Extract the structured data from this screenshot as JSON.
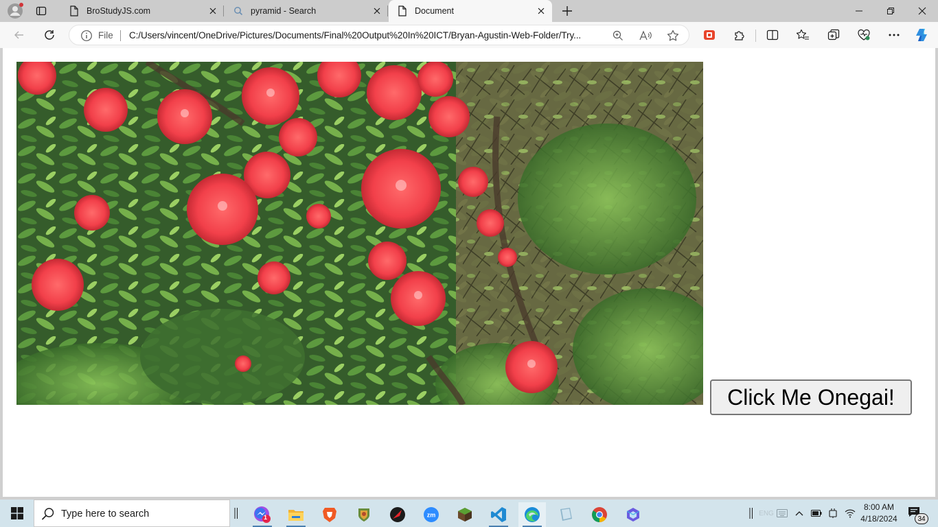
{
  "browser": {
    "tabs": [
      {
        "title": "BroStudyJS.com",
        "icon": "page-icon",
        "active": false
      },
      {
        "title": "pyramid - Search",
        "icon": "search-icon",
        "active": false
      },
      {
        "title": "Document",
        "icon": "page-icon",
        "active": true
      }
    ],
    "address": {
      "scheme_label": "File",
      "url": "C:/Users/vincent/OneDrive/Pictures/Documents/Final%20Output%20In%20ICT/Bryan-Agustin-Web-Folder/Try..."
    }
  },
  "page": {
    "photo": {
      "subject": "red ixora flowers bush"
    },
    "button_label": "Click Me Onegai!"
  },
  "taskbar": {
    "search_placeholder": "Type here to search",
    "messenger_badge": "1",
    "clock_time": "8:00 AM",
    "clock_date": "4/18/2024",
    "notification_count": "34",
    "language": "ENG"
  },
  "colors": {
    "tabstrip_bg": "#cccccc",
    "toolbar_bg": "#f7f7f7",
    "taskbar_bg": "#d3e4ec",
    "button_bg": "#efefef",
    "accent": "#0078d4"
  }
}
